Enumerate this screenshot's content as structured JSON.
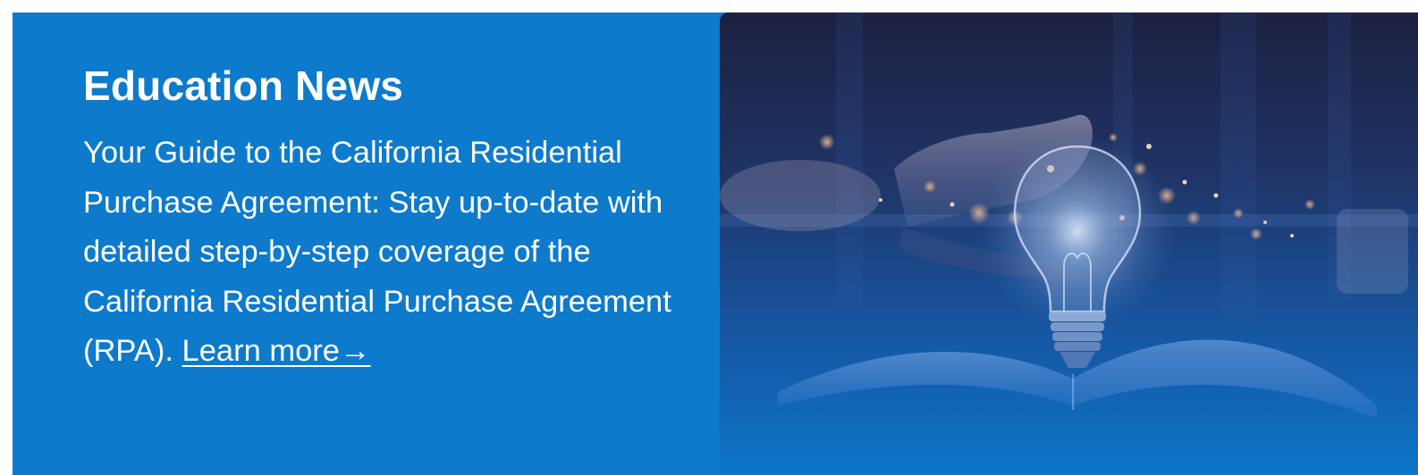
{
  "banner": {
    "title": "Education News",
    "description": "Your Guide to the California Residential Purchase Agreement: Stay up-to-date with detailed step-by-step coverage of the California Residential Purchase Agreement (RPA).",
    "link_label": "Learn more→"
  },
  "colors": {
    "banner_background": "#0d7acc",
    "text": "#ffffff",
    "image_top": "#1a2347",
    "image_bottom": "#0d75c8"
  },
  "image": {
    "icon": "lightbulb-over-open-book-photo"
  }
}
